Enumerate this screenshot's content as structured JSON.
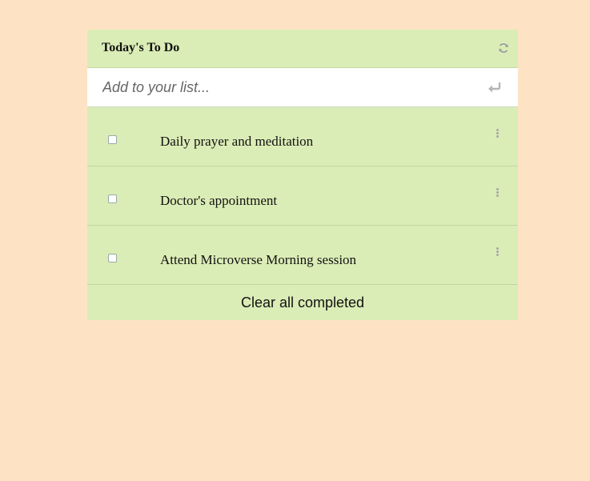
{
  "header": {
    "title": "Today's To Do",
    "refresh_icon": "refresh-icon"
  },
  "add_input": {
    "placeholder": "Add to your list...",
    "value": "",
    "enter_icon": "enter-return-icon"
  },
  "items": [
    {
      "label": "Daily prayer and meditation",
      "completed": false
    },
    {
      "label": "Doctor's appointment",
      "completed": false
    },
    {
      "label": "Attend Microverse Morning session",
      "completed": false
    }
  ],
  "footer": {
    "clear_label": "Clear all completed"
  },
  "colors": {
    "page_background": "#fde3c4",
    "card_background": "#dbedb6",
    "input_background": "#ffffff"
  }
}
